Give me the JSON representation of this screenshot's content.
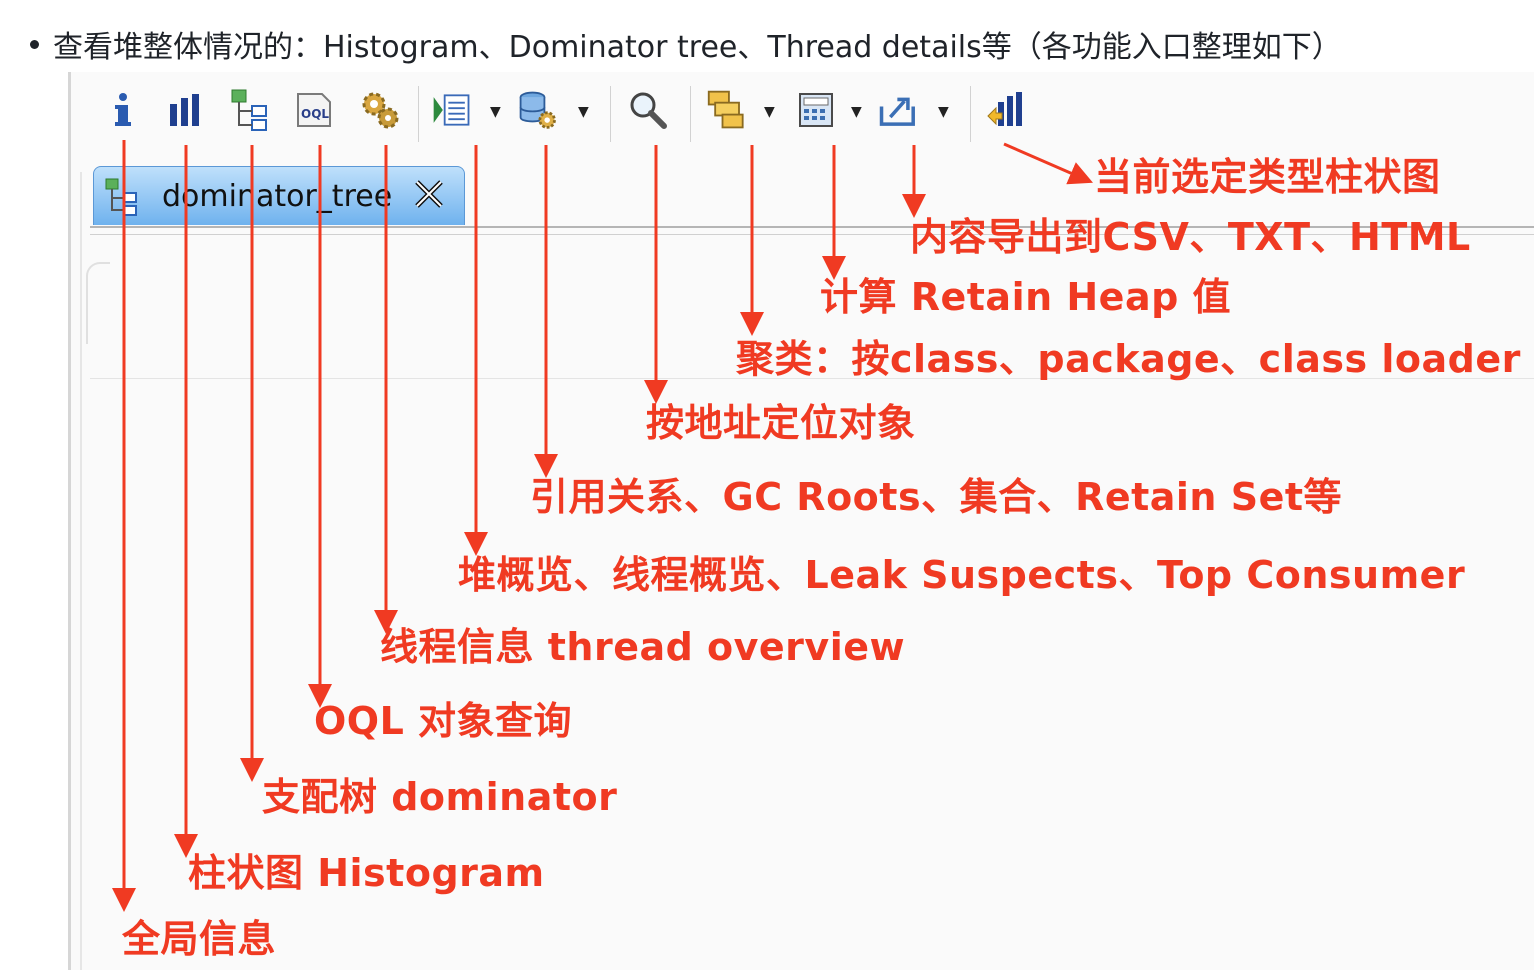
{
  "intro": {
    "text": "查看堆整体情况的：Histogram、Dominator tree、Thread details等（各功能入口整理如下）"
  },
  "toolbar": {
    "icons": [
      "info-icon",
      "histogram-icon",
      "dominator-tree-icon",
      "oql-icon",
      "thread-overview-icon",
      "heap-overview-icon",
      "query-browser-icon",
      "search-object-icon",
      "group-by-icon",
      "calculate-retained-icon",
      "export-icon",
      "selected-type-histogram-icon"
    ]
  },
  "tab": {
    "label": "dominator_tree"
  },
  "annotations": {
    "selected_type_histogram": "当前选定类型柱状图",
    "export": "内容导出到CSV、TXT、HTML",
    "calc_retain_heap": "计算 Retain Heap 值",
    "group_by": "聚类：按class、package、class loader",
    "locate_by_address": "按地址定位对象",
    "query_browser": "引用关系、GC Roots、集合、Retain Set等",
    "overview": "堆概览、线程概览、Leak Suspects、Top Consumer",
    "thread_overview": "线程信息 thread overview",
    "oql": "OQL 对象查询",
    "dominator": "支配树 dominator",
    "histogram": "柱状图 Histogram",
    "global_info": "全局信息"
  },
  "colors": {
    "annotation": "#f03a22",
    "tab_top": "#bfe0fb",
    "tab_bottom": "#6fb2ee"
  }
}
